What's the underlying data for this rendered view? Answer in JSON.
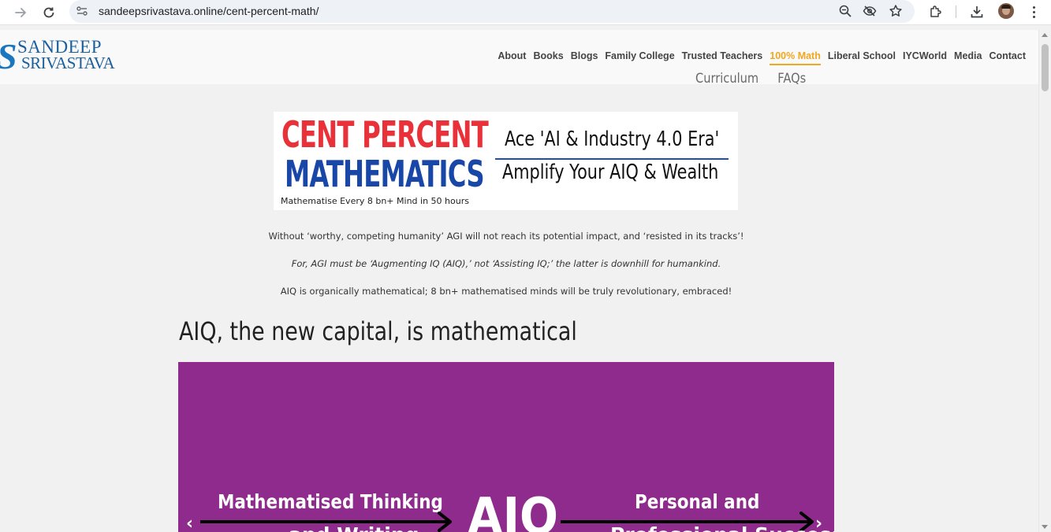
{
  "browser": {
    "url": "sandeepsrivastava.online/cent-percent-math/",
    "back_icon": "arrow-forward-icon",
    "reload_icon": "reload-icon"
  },
  "site": {
    "logo_line1": "SANDEEP",
    "logo_line2": "SRIVASTAVA",
    "nav": [
      {
        "label": "About"
      },
      {
        "label": "Books"
      },
      {
        "label": "Blogs"
      },
      {
        "label": "Family College"
      },
      {
        "label": "Trusted Teachers"
      },
      {
        "label": "100% Math",
        "active": true
      },
      {
        "label": "Liberal School"
      },
      {
        "label": "IYCWorld"
      },
      {
        "label": "Media"
      },
      {
        "label": "Contact"
      }
    ],
    "subnav": [
      {
        "label": "Curriculum"
      },
      {
        "label": "FAQs"
      }
    ],
    "accent_color": "#f0a81f"
  },
  "banner": {
    "title_line1": "CENT PERCENT",
    "title_line2": "MATHEMATICS",
    "tagline": "Mathematise Every 8 bn+ Mind in 50 hours",
    "right_line1": "Ace 'AI & Industry 4.0 Era'",
    "right_line2": "Amplify Your AIQ & Wealth"
  },
  "intro": {
    "p1": "Without ‘worthy, competing humanity’ AGI will not reach its potential impact, and ‘resisted in its tracks’!",
    "p2": "For, AGI must be ‘Augmenting IQ (AIQ),’ not ‘Assisting IQ;’ the latter is downhill for humankind.",
    "p3": "AIQ is organically mathematical; 8 bn+ mathematised minds will be truly revolutionary, embraced!"
  },
  "section": {
    "heading": "AIQ, the new capital, is mathematical"
  },
  "slider": {
    "left_label": "Mathematised Thinking",
    "left_label2": "and Writing",
    "center_label": "AIQ",
    "right_label": "Personal and",
    "right_label2": "Professional Success",
    "prev_glyph": "‹",
    "next_glyph": "›",
    "background": "#8e2b8c"
  }
}
